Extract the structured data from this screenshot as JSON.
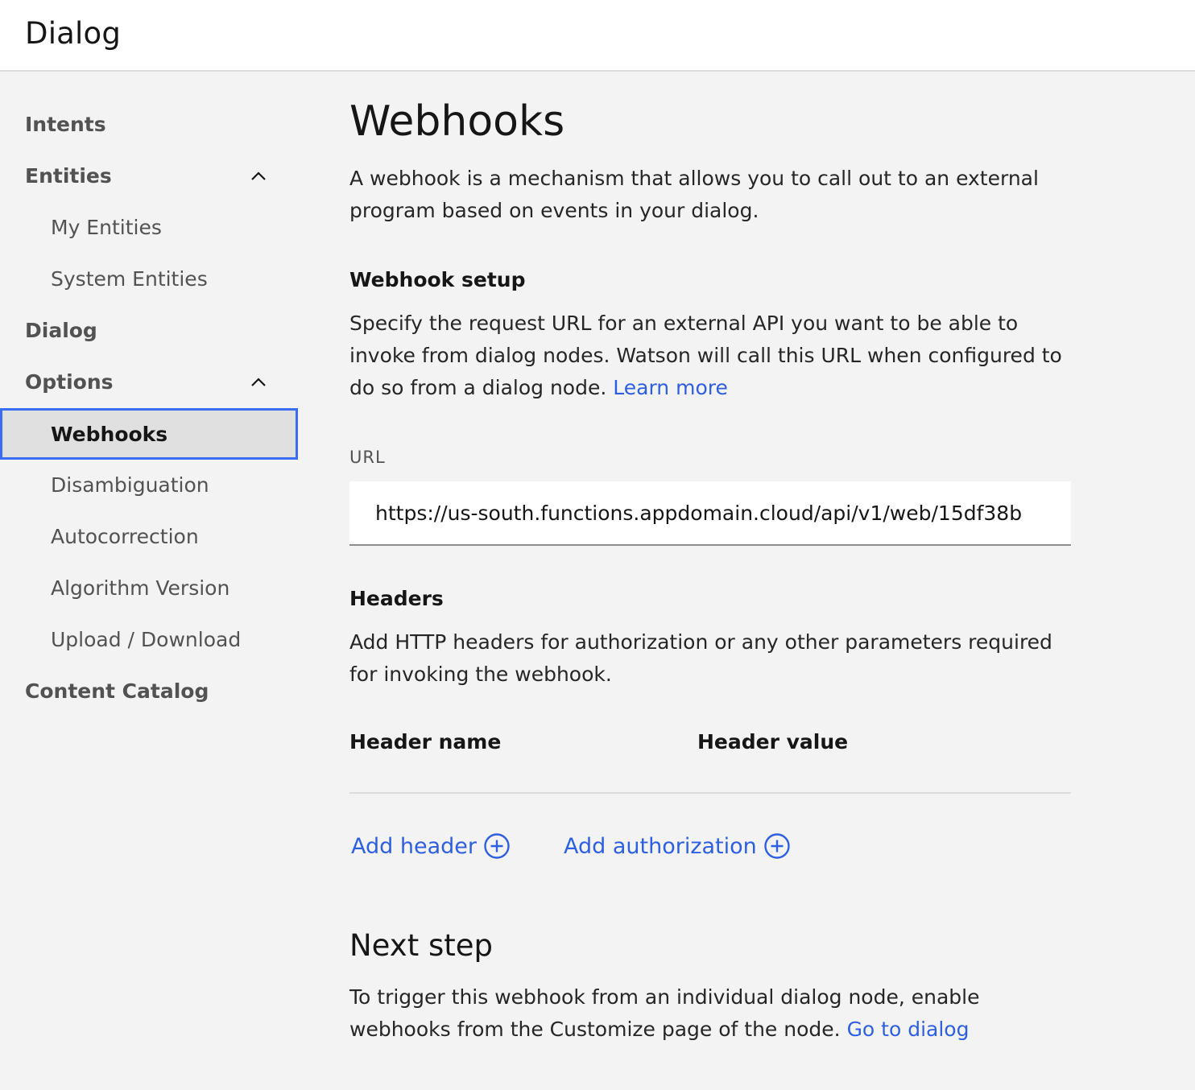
{
  "header": {
    "title": "Dialog"
  },
  "sidebar": {
    "items": [
      {
        "label": "Intents",
        "level": "top"
      },
      {
        "label": "Entities",
        "level": "top",
        "expanded": true
      },
      {
        "label": "My Entities",
        "level": "sub"
      },
      {
        "label": "System Entities",
        "level": "sub"
      },
      {
        "label": "Dialog",
        "level": "top"
      },
      {
        "label": "Options",
        "level": "top",
        "expanded": true
      },
      {
        "label": "Webhooks",
        "level": "sub",
        "active": true
      },
      {
        "label": "Disambiguation",
        "level": "sub"
      },
      {
        "label": "Autocorrection",
        "level": "sub"
      },
      {
        "label": "Algorithm Version",
        "level": "sub"
      },
      {
        "label": "Upload / Download",
        "level": "sub"
      },
      {
        "label": "Content Catalog",
        "level": "top"
      }
    ]
  },
  "main": {
    "title": "Webhooks",
    "intro": "A webhook is a mechanism that allows you to call out to an external program based on events in your dialog.",
    "setup": {
      "heading": "Webhook setup",
      "text": "Specify the request URL for an external API you want to be able to invoke from dialog nodes. Watson will call this URL when configured to do so from a dialog node.",
      "learn_more": "Learn more"
    },
    "url": {
      "label": "URL",
      "value": "https://us-south.functions.appdomain.cloud/api/v1/web/15df38b"
    },
    "headers": {
      "heading": "Headers",
      "text": "Add HTTP headers for authorization or any other parameters required for invoking the webhook.",
      "col_name": "Header name",
      "col_value": "Header value",
      "add_header": "Add header",
      "add_authorization": "Add authorization"
    },
    "next": {
      "heading": "Next step",
      "text": "To trigger this webhook from an individual dialog node, enable webhooks from the Customize page of the node.",
      "go_to_dialog": "Go to dialog"
    }
  },
  "colors": {
    "accent": "#3a6df0",
    "link": "#2e5fe0",
    "background": "#f3f3f3"
  },
  "icons": {
    "chevron": "chevron-up-icon",
    "add": "add-circle-icon"
  }
}
